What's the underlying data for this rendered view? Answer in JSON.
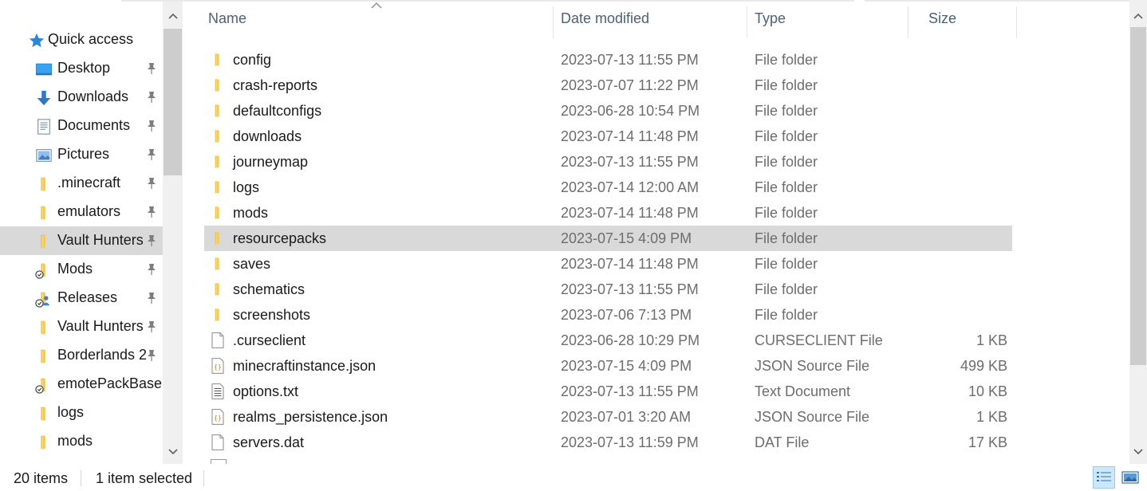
{
  "navigation": {
    "quick_access": {
      "label": "Quick access",
      "icon": "star-icon"
    },
    "items": [
      {
        "label": "Desktop",
        "icon": "desktop-icon",
        "pinned": true
      },
      {
        "label": "Downloads",
        "icon": "download-arrow-icon",
        "pinned": true
      },
      {
        "label": "Documents",
        "icon": "documents-icon",
        "pinned": true
      },
      {
        "label": "Pictures",
        "icon": "pictures-icon",
        "pinned": true
      },
      {
        "label": ".minecraft",
        "icon": "folder-icon",
        "pinned": true
      },
      {
        "label": "emulators",
        "icon": "folder-icon",
        "pinned": true
      },
      {
        "label": "Vault Hunters",
        "icon": "folder-icon",
        "pinned": true,
        "selected": true
      },
      {
        "label": "Mods",
        "icon": "folder-synced-icon",
        "pinned": true
      },
      {
        "label": "Releases",
        "icon": "folder-shared-icon",
        "pinned": true
      },
      {
        "label": "Vault Hunters",
        "icon": "folder-icon",
        "pinned": true
      },
      {
        "label": "Borderlands 2",
        "icon": "folder-icon",
        "pinned": true
      },
      {
        "label": "emotePackBase",
        "icon": "folder-synced-icon",
        "pinned": false
      },
      {
        "label": "logs",
        "icon": "folder-icon",
        "pinned": false
      },
      {
        "label": "mods",
        "icon": "folder-icon",
        "pinned": false
      }
    ]
  },
  "columns": {
    "name": "Name",
    "date": "Date modified",
    "type": "Type",
    "size": "Size"
  },
  "files": [
    {
      "name": "config",
      "date": "2023-07-13 11:55 PM",
      "type": "File folder",
      "size": "",
      "icon": "folder-icon"
    },
    {
      "name": "crash-reports",
      "date": "2023-07-07 11:22 PM",
      "type": "File folder",
      "size": "",
      "icon": "folder-icon"
    },
    {
      "name": "defaultconfigs",
      "date": "2023-06-28 10:54 PM",
      "type": "File folder",
      "size": "",
      "icon": "folder-icon"
    },
    {
      "name": "downloads",
      "date": "2023-07-14 11:48 PM",
      "type": "File folder",
      "size": "",
      "icon": "folder-icon"
    },
    {
      "name": "journeymap",
      "date": "2023-07-13 11:55 PM",
      "type": "File folder",
      "size": "",
      "icon": "folder-icon"
    },
    {
      "name": "logs",
      "date": "2023-07-14 12:00 AM",
      "type": "File folder",
      "size": "",
      "icon": "folder-icon"
    },
    {
      "name": "mods",
      "date": "2023-07-14 11:48 PM",
      "type": "File folder",
      "size": "",
      "icon": "folder-icon"
    },
    {
      "name": "resourcepacks",
      "date": "2023-07-15 4:09 PM",
      "type": "File folder",
      "size": "",
      "icon": "folder-icon",
      "selected": true
    },
    {
      "name": "saves",
      "date": "2023-07-14 11:48 PM",
      "type": "File folder",
      "size": "",
      "icon": "folder-icon"
    },
    {
      "name": "schematics",
      "date": "2023-07-13 11:55 PM",
      "type": "File folder",
      "size": "",
      "icon": "folder-icon"
    },
    {
      "name": "screenshots",
      "date": "2023-07-06 7:13 PM",
      "type": "File folder",
      "size": "",
      "icon": "folder-icon"
    },
    {
      "name": ".curseclient",
      "date": "2023-06-28 10:29 PM",
      "type": "CURSECLIENT File",
      "size": "1 KB",
      "icon": "blank-file-icon"
    },
    {
      "name": "minecraftinstance.json",
      "date": "2023-07-15 4:09 PM",
      "type": "JSON Source File",
      "size": "499 KB",
      "icon": "json-file-icon"
    },
    {
      "name": "options.txt",
      "date": "2023-07-13 11:55 PM",
      "type": "Text Document",
      "size": "10 KB",
      "icon": "text-file-icon"
    },
    {
      "name": "realms_persistence.json",
      "date": "2023-07-01 3:20 AM",
      "type": "JSON Source File",
      "size": "1 KB",
      "icon": "json-file-icon"
    },
    {
      "name": "servers.dat",
      "date": "2023-07-13 11:59 PM",
      "type": "DAT File",
      "size": "17 KB",
      "icon": "blank-file-icon"
    }
  ],
  "status": {
    "item_count": "20 items",
    "selection": "1 item selected"
  },
  "colors": {
    "selection": "#d9d9d9",
    "folder": "#f8d775",
    "header_text": "#4c607a",
    "accent": "#0078d7"
  }
}
